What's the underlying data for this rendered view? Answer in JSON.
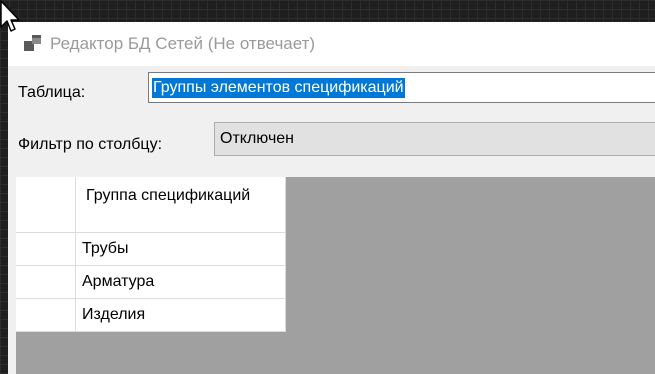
{
  "window": {
    "title": "Редактор БД Сетей (Не отвечает)"
  },
  "form": {
    "table_label": "Таблица:",
    "table_value": "Группы элементов спецификаций",
    "filter_label": "Фильтр по столбцу:",
    "filter_value": "Отключен"
  },
  "grid": {
    "column_header": "Группа спецификаций",
    "rows": [
      "Трубы",
      "Арматура",
      "Изделия"
    ]
  },
  "colors": {
    "selection": "#0078d7",
    "grid_background": "#a0a0a0",
    "title_text": "#9a9a9a"
  },
  "icons": {
    "app": "database-app-icon",
    "cursor": "mouse-pointer-icon"
  }
}
